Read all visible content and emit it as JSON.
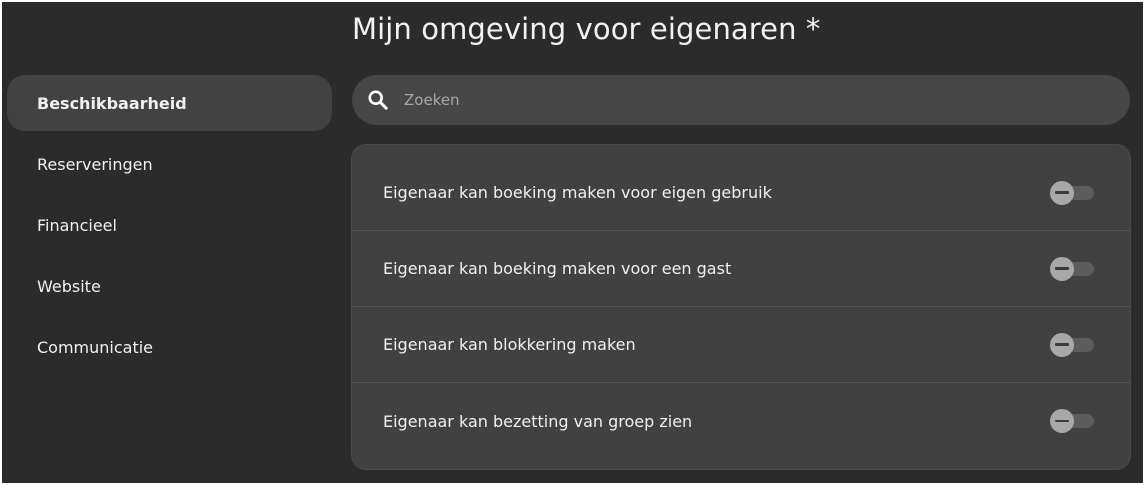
{
  "page": {
    "title": "Mijn omgeving voor eigenaren *"
  },
  "sidebar": {
    "active_index": 0,
    "items": [
      {
        "label": "Beschikbaarheid",
        "active": true
      },
      {
        "label": "Reserveringen",
        "active": false
      },
      {
        "label": "Financieel",
        "active": false
      },
      {
        "label": "Website",
        "active": false
      },
      {
        "label": "Communicatie",
        "active": false
      }
    ]
  },
  "search": {
    "icon": "search-icon",
    "placeholder": "Zoeken",
    "value": ""
  },
  "settings": {
    "items": [
      {
        "label": "Eigenaar kan boeking maken voor eigen gebruik",
        "enabled": false,
        "state": "unset"
      },
      {
        "label": "Eigenaar kan boeking maken voor een gast",
        "enabled": false,
        "state": "unset"
      },
      {
        "label": "Eigenaar kan blokkering maken",
        "enabled": false,
        "state": "unset"
      },
      {
        "label": "Eigenaar kan bezetting van groep zien",
        "enabled": false,
        "state": "unset"
      }
    ]
  },
  "colors": {
    "background": "#2b2b2b",
    "sidebar_active": "#424242",
    "search_background": "#474747",
    "card_background": "#414141",
    "text": "#f0f0f0",
    "toggle_knob": "#a8a8a8",
    "toggle_track": "#5c5c5c"
  }
}
